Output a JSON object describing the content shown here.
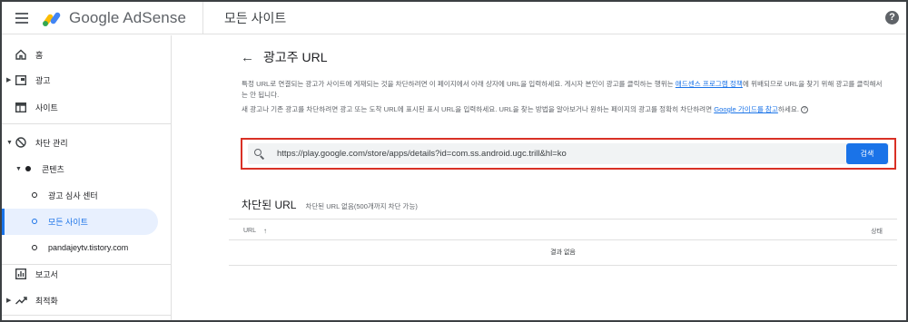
{
  "header": {
    "app_name": "Google AdSense",
    "page_title": "모든 사이트",
    "help_icon": "help-icon"
  },
  "sidebar": {
    "items": [
      {
        "label": "홈",
        "icon": "home-icon"
      },
      {
        "label": "광고",
        "icon": "ads-icon"
      },
      {
        "label": "사이트",
        "icon": "sites-icon"
      },
      {
        "label": "차단 관리",
        "icon": "block-icon"
      },
      {
        "label": "콘텐츠"
      },
      {
        "label": "광고 심사 센터"
      },
      {
        "label": "모든 사이트"
      },
      {
        "label": "pandajeytv.tistory.com"
      },
      {
        "label": "보고서",
        "icon": "reports-icon"
      },
      {
        "label": "최적화",
        "icon": "optimization-icon"
      }
    ]
  },
  "main": {
    "title": "광고주 URL",
    "desc1_pre": "특정 URL로 연결되는 광고가 사이트에 게재되는 것을 차단하려면 이 페이지에서 아래 상자에 URL을 입력하세요. 게시자 본인이 광고를 클릭하는 행위는 ",
    "desc1_link": "애드센스 프로그램 정책",
    "desc1_post": "에 위배되므로 URL을 찾기 위해 광고를 클릭해서는 안 됩니다.",
    "desc2_pre": "새 광고나 기존 광고를 차단하려면 광고 또는 도착 URL에 표시된 표시 URL을 입력하세요. URL을 찾는 방법을 알아보거나 원하는 페이지의 광고를 정확히 차단하려면 ",
    "desc2_link": "Google 가이드를 참고",
    "desc2_post": "하세요.",
    "search": {
      "value": "https://play.google.com/store/apps/details?id=com.ss.android.ugc.trill&hl=ko",
      "button_label": "검색"
    },
    "blocked": {
      "title": "차단된 URL",
      "subtitle": "차단된 URL 없음(500개까지 차단 가능)"
    },
    "table": {
      "col_url": "URL",
      "col_status": "상태",
      "empty": "결과 없음"
    }
  }
}
